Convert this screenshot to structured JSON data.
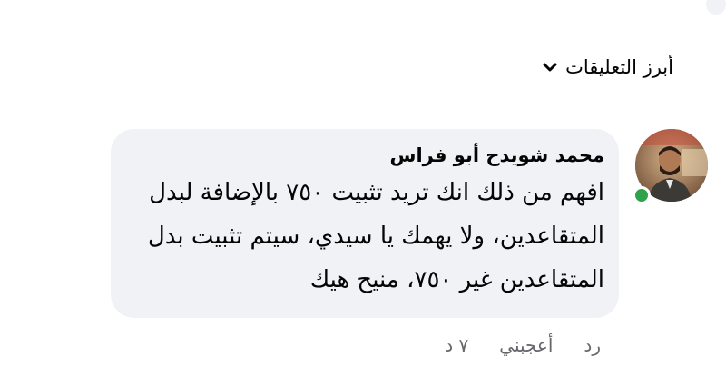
{
  "filter": {
    "label": "أبرز التعليقات",
    "icon": "chevron-down-icon"
  },
  "comment": {
    "author": "محمد شويدح أبو فراس",
    "text": "افهم من ذلك انك تريد تثبيت ٧٥٠ بالإضافة لبدل المتقاعدين، ولا يهمك يا سيدي، سيتم تثبيت بدل المتقاعدين غير ٧٥٠، منيح هيك",
    "online": true,
    "avatar_icon": "profile-photo"
  },
  "actions": {
    "timestamp": "٧ د",
    "like_label": "أعجبني",
    "reply_label": "رد"
  },
  "colors": {
    "bubble_background": "#f0f2f5",
    "secondary_text": "#65676b",
    "online_status": "#31a24c"
  }
}
